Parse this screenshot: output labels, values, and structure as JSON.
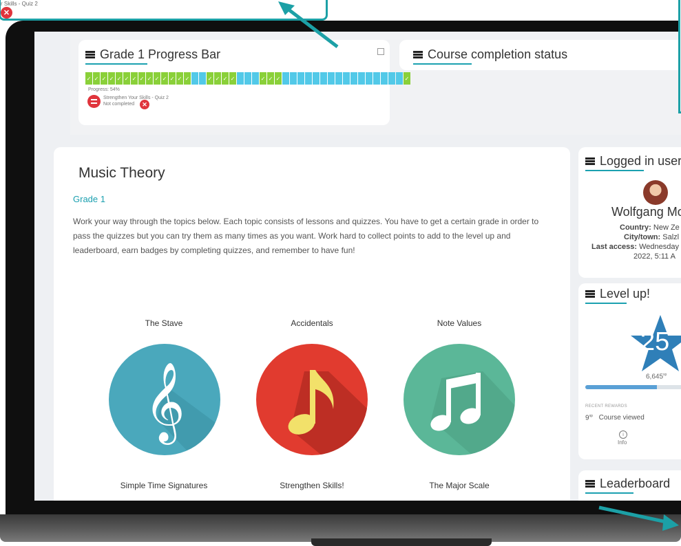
{
  "zoom_callout": {
    "text": "r Skills - Quiz 2"
  },
  "progress_card": {
    "title": "Grade 1 Progress Bar",
    "segments": [
      1,
      1,
      1,
      1,
      1,
      1,
      1,
      1,
      1,
      1,
      1,
      1,
      1,
      1,
      0,
      0,
      1,
      1,
      1,
      1,
      0,
      0,
      0,
      1,
      1,
      1,
      0,
      0,
      0,
      0,
      0,
      0,
      0,
      0,
      0,
      0,
      0,
      0,
      0,
      0,
      0,
      0,
      1
    ],
    "progress_text": "Progress: 54%",
    "activity_name": "Strengthen Your Skills - Quiz 2",
    "activity_status": "Not completed"
  },
  "completion_card": {
    "title": "Course completion status"
  },
  "main": {
    "title": "Music Theory",
    "subtitle": "Grade 1",
    "paragraph_line1": "Work your way through the topics below. Each topic consists of lessons and quizzes. You have to get a certain grade in order to",
    "paragraph_line2": "pass the quizzes but you can try them as many times as you want. Work hard to collect points to add to the level up and",
    "paragraph_line3": "leaderboard, earn badges by completing quizzes, and remember to have fun!",
    "topics": [
      {
        "label": "The Stave",
        "color": "#4aa8bc"
      },
      {
        "label": "Accidentals",
        "color": "#e13b2f"
      },
      {
        "label": "Note Values",
        "color": "#5bb798"
      }
    ],
    "topics_row2": [
      "Simple Time Signatures",
      "Strengthen Skills!",
      "The Major Scale"
    ]
  },
  "logged_user": {
    "title": "Logged in user",
    "name": "Wolfgang Mo",
    "country_label": "Country:",
    "country_value": "New Ze",
    "city_label": "City/town:",
    "city_value": "Salzl",
    "access_label": "Last access:",
    "access_value": "Wednesday",
    "access_line2": "2022, 5:11 A"
  },
  "level_up": {
    "title": "Level up!",
    "level": "25",
    "xp": "6,645",
    "xp_unit": "xp",
    "progress_fraction": 0.65,
    "recent_rewards_label": "RECENT REWARDS",
    "reward_points": "9",
    "reward_unit": "xp",
    "reward_text": "Course viewed",
    "info_label": "Info"
  },
  "leaderboard": {
    "title": "Leaderboard"
  },
  "colors": {
    "accent": "#1aa0b0",
    "progress_done": "#8ad039",
    "progress_todo": "#52c9e8",
    "level_star": "#2f7fb8"
  }
}
